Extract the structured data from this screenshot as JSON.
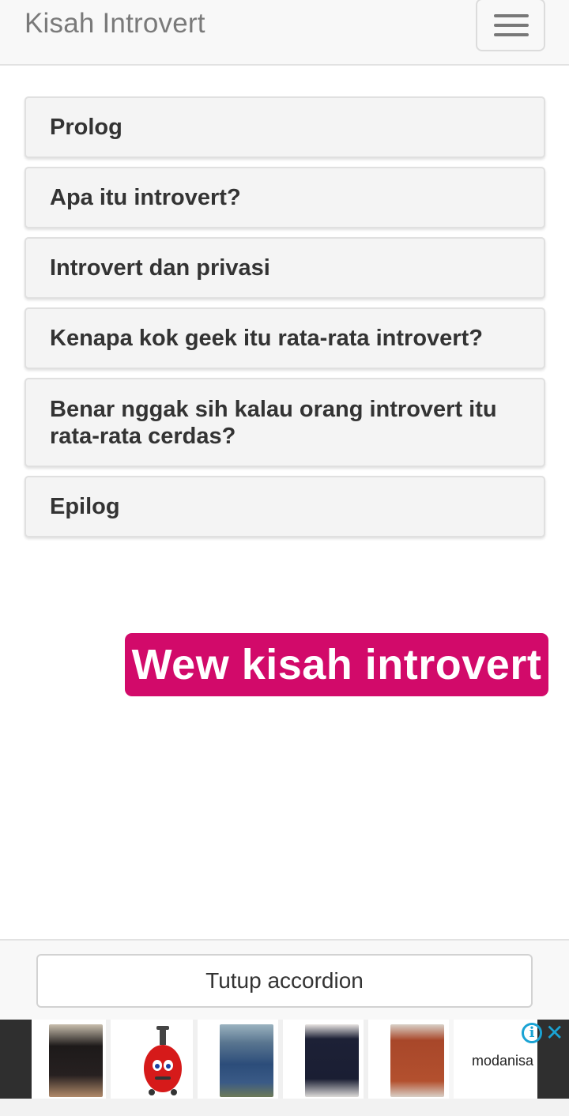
{
  "navbar": {
    "brand": "Kisah Introvert",
    "toggler_icon": "hamburger-menu-icon"
  },
  "accordion": {
    "items": [
      {
        "label": "Prolog"
      },
      {
        "label": "Apa itu introvert?"
      },
      {
        "label": "Introvert dan privasi"
      },
      {
        "label": "Kenapa kok geek itu rata-rata introvert?"
      },
      {
        "label": "Benar nggak sih kalau orang introvert itu rata-rata cerdas?"
      },
      {
        "label": "Epilog"
      }
    ]
  },
  "banner": {
    "text": "Wew kisah introvert",
    "color": "#d20a6a"
  },
  "footer": {
    "close_button": "Tutup accordion"
  },
  "ad": {
    "brand": "modanisa",
    "info_icon": "info-icon",
    "close_icon": "close-icon",
    "products": [
      {
        "name": "floral-dress-thumbnail"
      },
      {
        "name": "kids-luggage-thumbnail"
      },
      {
        "name": "denim-set-thumbnail"
      },
      {
        "name": "navy-tunic-thumbnail"
      },
      {
        "name": "rust-dress-thumbnail"
      }
    ]
  }
}
